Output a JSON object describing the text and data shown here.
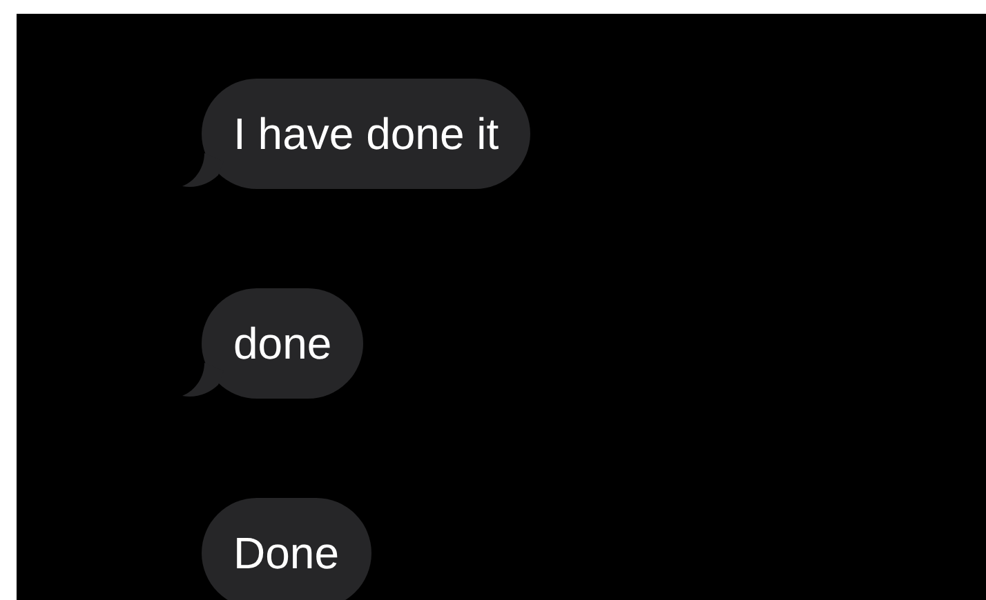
{
  "messages": [
    {
      "text": "I have done it",
      "tail": true
    },
    {
      "text": "done",
      "tail": true
    },
    {
      "text": "Done",
      "tail": false
    }
  ]
}
